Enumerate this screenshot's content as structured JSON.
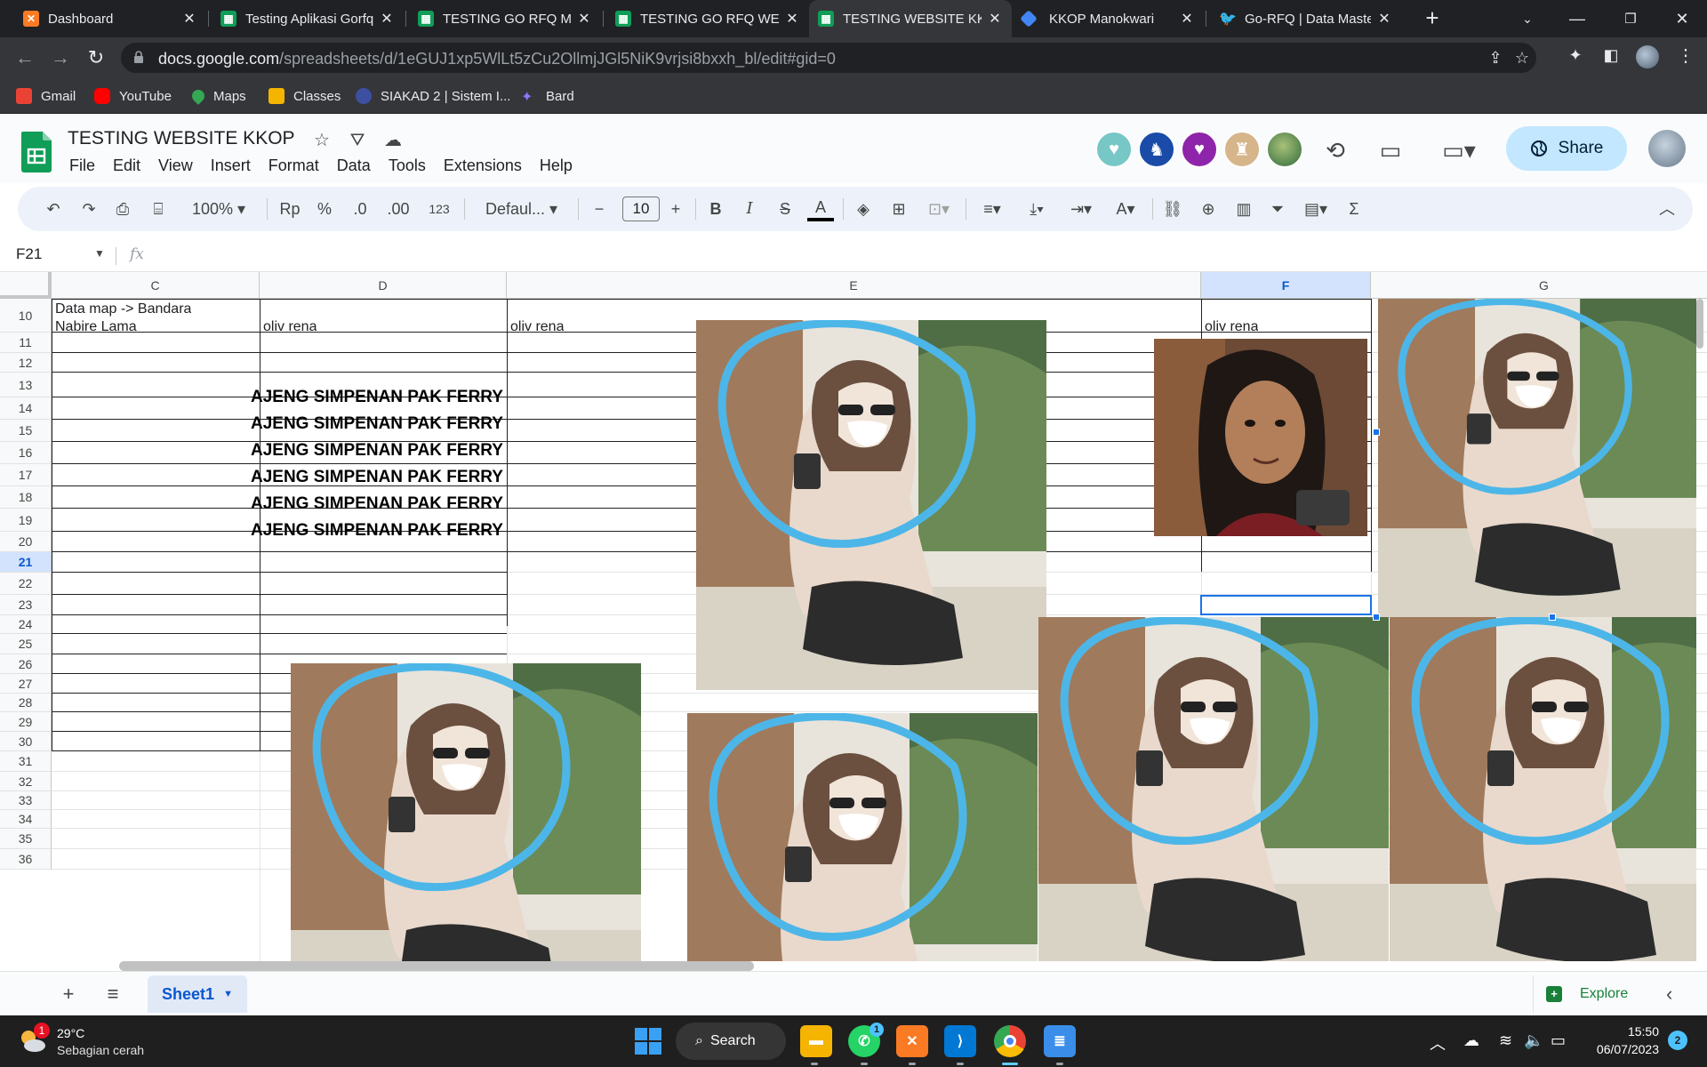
{
  "browser": {
    "tabs": [
      {
        "title": "Dashboard",
        "favicon": "xampp-icon",
        "color": "#fb7a24"
      },
      {
        "title": "Testing Aplikasi Gorfq",
        "favicon": "sheets-icon",
        "color": "#0f9d58"
      },
      {
        "title": "TESTING GO RFQ MO",
        "favicon": "sheets-icon",
        "color": "#0f9d58"
      },
      {
        "title": "TESTING GO RFQ WE",
        "favicon": "sheets-icon",
        "color": "#0f9d58"
      },
      {
        "title": "TESTING WEBSITE KK",
        "favicon": "sheets-icon",
        "color": "#0f9d58",
        "active": true
      },
      {
        "title": "KKOP Manokwari",
        "favicon": "diamond-icon",
        "color": "#4285f4"
      },
      {
        "title": "Go-RFQ | Data Master",
        "favicon": "bird-icon",
        "color": "#e8710a"
      }
    ],
    "url_host": "docs.google.com",
    "url_path": "/spreadsheets/d/1eGUJ1xp5WlLt5zCu2OllmjJGl5NiK9vrjsi8bxxh_bl/edit#gid=0",
    "bookmarks": [
      {
        "label": "Gmail",
        "color": "#ea4335"
      },
      {
        "label": "YouTube",
        "color": "#ff0000"
      },
      {
        "label": "Maps",
        "color": "#34a853"
      },
      {
        "label": "Classes",
        "color": "#f4b400"
      },
      {
        "label": "SIAKAD 2 | Sistem I...",
        "color": "#3c4fa0"
      },
      {
        "label": "Bard",
        "color": "#8e75ff"
      }
    ]
  },
  "sheets": {
    "title": "TESTING WEBSITE KKOP",
    "menu": [
      "File",
      "Edit",
      "View",
      "Insert",
      "Format",
      "Data",
      "Tools",
      "Extensions",
      "Help"
    ],
    "share_label": "Share",
    "collaborators": [
      {
        "color": "#78c7c7",
        "icon": "otter-icon"
      },
      {
        "color": "#1a4ba8",
        "icon": "cat-icon"
      },
      {
        "color": "#8e24aa",
        "icon": "unicorn-icon"
      },
      {
        "color": "#d7b58b",
        "icon": "giraffe-icon"
      },
      {
        "color": "#2e6b3a",
        "icon": "user-photo"
      }
    ],
    "toolbar": {
      "zoom": "100%",
      "currency": "Rp",
      "percent": "%",
      "dec_decrease": ".0",
      "dec_increase": ".00",
      "format_123": "123",
      "font": "Defaul...",
      "font_size": "10",
      "bold": "B",
      "italic": "I",
      "strike": "S",
      "text_color": "A",
      "sum": "Σ"
    },
    "name_box": "F21",
    "fx_label": "fx",
    "columns": [
      "C",
      "D",
      "E",
      "F",
      "G"
    ],
    "selected_column": "F",
    "rows": [
      "10",
      "11",
      "12",
      "13",
      "14",
      "15",
      "16",
      "17",
      "18",
      "19",
      "20",
      "21",
      "22",
      "23",
      "24",
      "25",
      "26",
      "27",
      "28",
      "29",
      "30",
      "31",
      "32",
      "33",
      "34",
      "35",
      "36"
    ],
    "selected_row": "21",
    "row10": {
      "c_line1": "Data map -> Bandara",
      "c_line2": "Nabire Lama",
      "d": "oliv rena",
      "e": "oliv rena",
      "f": "oliv rena"
    },
    "bold_rows": [
      "AJENG SIMPENAN PAK FERRY",
      "AJENG SIMPENAN PAK FERRY",
      "AJENG SIMPENAN PAK FERRY",
      "AJENG SIMPENAN PAK FERRY",
      "AJENG SIMPENAN PAK FERRY",
      "AJENG SIMPENAN PAK FERRY"
    ],
    "sheet_tab": "Sheet1",
    "explore_label": "Explore"
  },
  "taskbar": {
    "weather_temp": "29°C",
    "weather_condition": "Sebagian cerah",
    "weather_badge": "1",
    "search_label": "Search",
    "whatsapp_badge": "1",
    "time": "15:50",
    "date": "06/07/2023",
    "notification_count": "2"
  }
}
